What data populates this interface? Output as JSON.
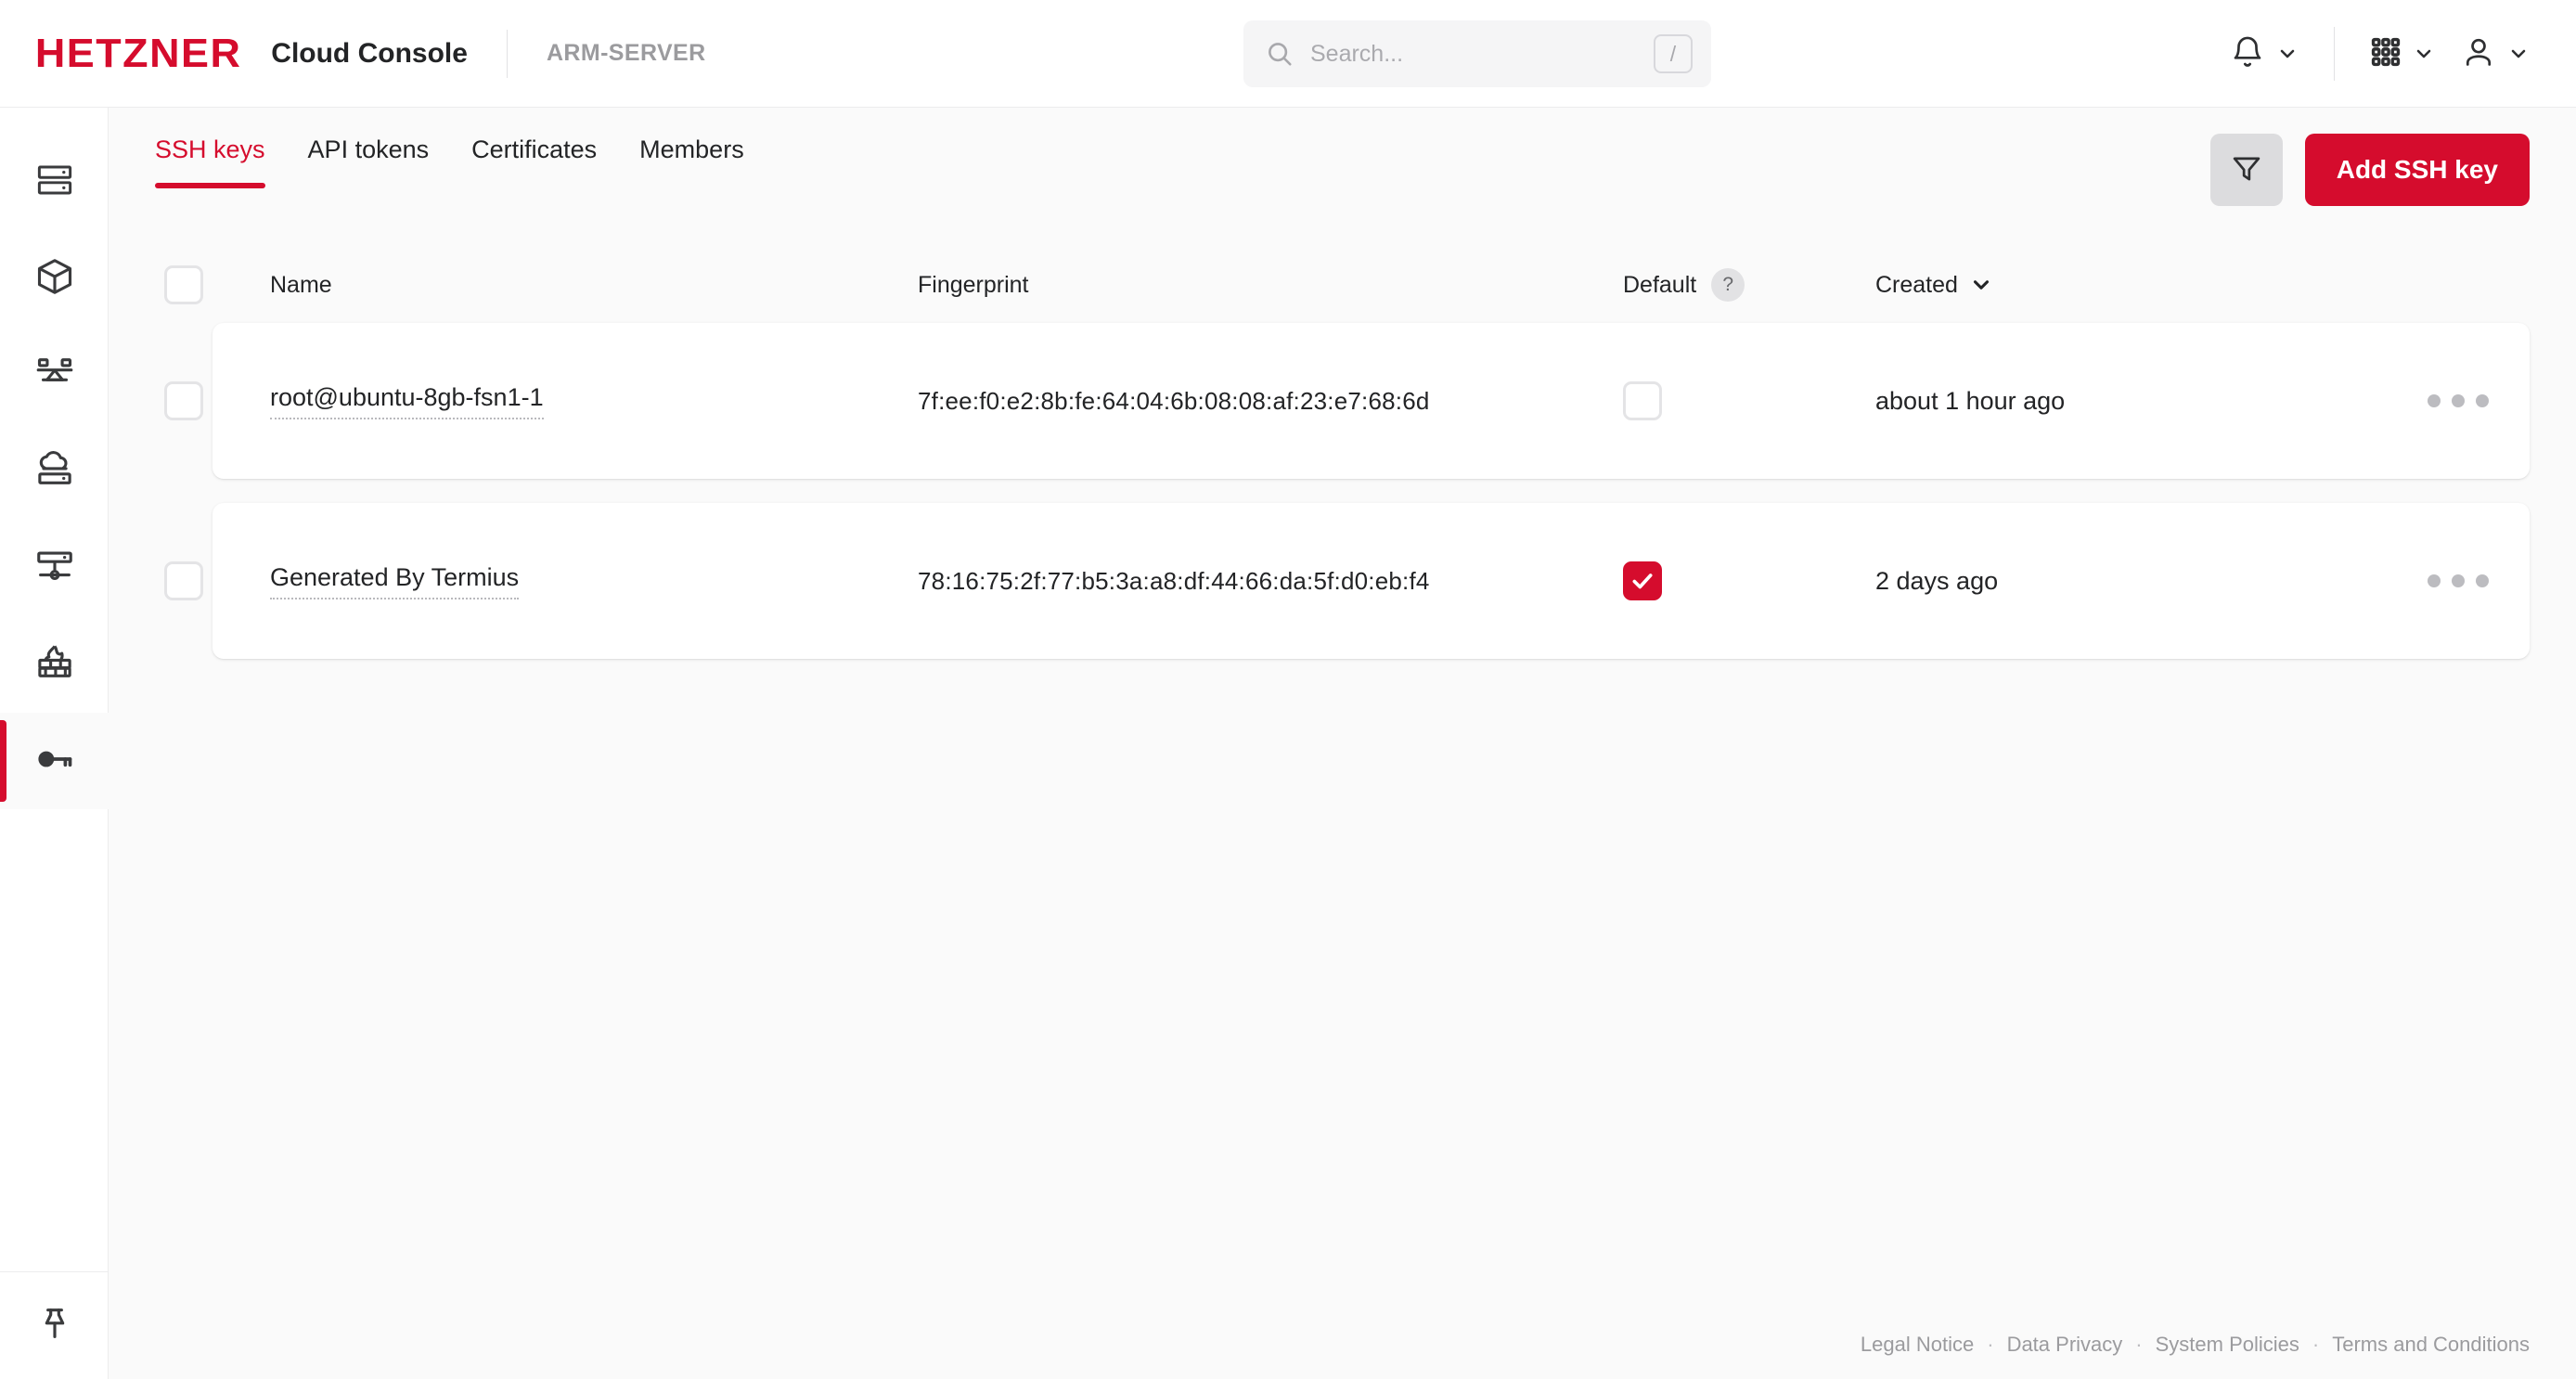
{
  "header": {
    "logo_text": "HETZNER",
    "console_title": "Cloud Console",
    "project_name": "ARM-SERVER",
    "search": {
      "placeholder": "Search...",
      "value": "",
      "shortcut_key": "/",
      "icon": "search-icon"
    },
    "actions": [
      {
        "icon": "bell-icon",
        "name": "notifications"
      },
      {
        "icon": "grid-apps-icon",
        "name": "apps"
      },
      {
        "icon": "user-icon",
        "name": "account"
      }
    ]
  },
  "sidebar": {
    "items": [
      {
        "icon": "server-icon",
        "name": "servers"
      },
      {
        "icon": "cube-icon",
        "name": "volumes"
      },
      {
        "icon": "load-balancer-icon",
        "name": "load-balancers"
      },
      {
        "icon": "cloud-server-icon",
        "name": "storage-boxes"
      },
      {
        "icon": "network-icon",
        "name": "networks"
      },
      {
        "icon": "firewall-icon",
        "name": "firewalls"
      },
      {
        "icon": "key-icon",
        "name": "security",
        "active": true
      }
    ],
    "bottom": {
      "icon": "pin-icon",
      "name": "pin-sidebar"
    }
  },
  "main": {
    "tabs": [
      {
        "label": "SSH keys",
        "active": true
      },
      {
        "label": "API tokens",
        "active": false
      },
      {
        "label": "Certificates",
        "active": false
      },
      {
        "label": "Members",
        "active": false
      }
    ],
    "filter_button": {
      "icon": "filter-icon",
      "label": "Filter"
    },
    "add_button": {
      "label": "Add SSH key"
    },
    "table": {
      "columns": [
        {
          "key": "name",
          "label": "Name"
        },
        {
          "key": "finger",
          "label": "Fingerprint"
        },
        {
          "key": "default",
          "label": "Default",
          "help": "?"
        },
        {
          "key": "created",
          "label": "Created",
          "sort": "desc"
        }
      ],
      "select_all_checked": false,
      "rows": [
        {
          "selected": false,
          "name": "root@ubuntu-8gb-fsn1-1",
          "fingerprint": "7f:ee:f0:e2:8b:fe:64:04:6b:08:08:af:23:e7:68:6d",
          "is_default": false,
          "created": "about 1 hour ago",
          "menu": "row-actions"
        },
        {
          "selected": false,
          "name": "Generated By Termius",
          "fingerprint": "78:16:75:2f:77:b5:3a:a8:df:44:66:da:5f:d0:eb:f4",
          "is_default": true,
          "created": "2 days ago",
          "menu": "row-actions"
        }
      ]
    }
  },
  "footer": {
    "links": [
      {
        "label": "Legal Notice"
      },
      {
        "label": "Data Privacy"
      },
      {
        "label": "System Policies"
      },
      {
        "label": "Terms and Conditions"
      }
    ],
    "separator": "·"
  },
  "colors": {
    "brand_red": "#d50c2d",
    "canvas_bg": "#fafafa",
    "card_bg": "#ffffff",
    "text": "#232426",
    "muted": "#9b9b9e"
  }
}
